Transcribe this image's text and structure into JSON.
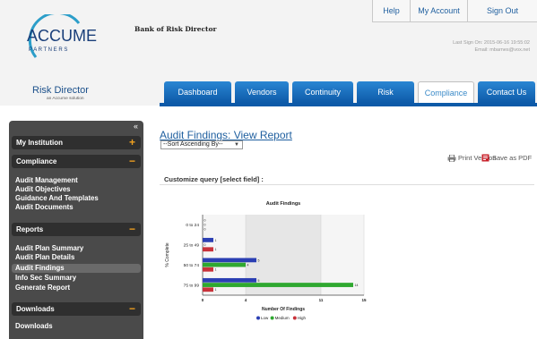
{
  "header": {
    "logo_word": "ACCUME",
    "logo_sub": "P A R T N E R S",
    "bank_name": "Bank of Risk Director",
    "product_name": "Risk Director",
    "product_tagline": "an Accume solution",
    "last_signon": "Last Sign On: 2015-06-16 19:55:02",
    "email": "Email: mbarnes@vox.net"
  },
  "util_nav": {
    "help": "Help",
    "account": "My Account",
    "signout": "Sign Out"
  },
  "main_nav": {
    "dashboard": "Dashboard",
    "vendors": "Vendors",
    "continuity": "Continuity",
    "risk": "Risk",
    "compliance": "Compliance",
    "contact": "Contact Us",
    "active": "Compliance"
  },
  "sidebar": {
    "collapse_glyph": "«",
    "sections": [
      {
        "title": "My Institution",
        "toggle": "+"
      },
      {
        "title": "Compliance",
        "toggle": "−"
      },
      {
        "title": "Reports",
        "toggle": "−"
      },
      {
        "title": "Downloads",
        "toggle": "−"
      }
    ],
    "compliance_links": [
      "Audit Management",
      "Audit Objectives",
      "Guidance And Templates",
      "Audit Documents"
    ],
    "report_links": [
      "Audit Plan Summary",
      "Audit Plan Details",
      "Audit Findings",
      "Info Sec Summary",
      "Generate Report"
    ],
    "download_links": [
      "Downloads"
    ],
    "active_link": "Audit Findings"
  },
  "main": {
    "title": "Audit Findings: View Report",
    "sort_value": "--Sort Ascending By--",
    "print_label": "Print Version",
    "pdf_label": "Save as PDF",
    "customize_label": "Customize query [select field] :"
  },
  "chart_data": {
    "type": "bar",
    "orientation": "horizontal",
    "title": "Audit Findings",
    "xlabel": "Number Of Findings",
    "ylabel": "% Complete",
    "xlim": [
      0,
      15
    ],
    "xticks": [
      0,
      4,
      11,
      15
    ],
    "categories": [
      "0 to 24",
      "25 to 49",
      "50 to 74",
      "75 to 99"
    ],
    "series": [
      {
        "name": "Low",
        "color": "#2b3fb3",
        "values": [
          0,
          1,
          5,
          5
        ]
      },
      {
        "name": "Medium",
        "color": "#2fa830",
        "values": [
          0,
          0,
          4,
          14
        ]
      },
      {
        "name": "High",
        "color": "#c8323a",
        "values": [
          0,
          1,
          1,
          1
        ]
      }
    ],
    "legend_position": "bottom"
  }
}
